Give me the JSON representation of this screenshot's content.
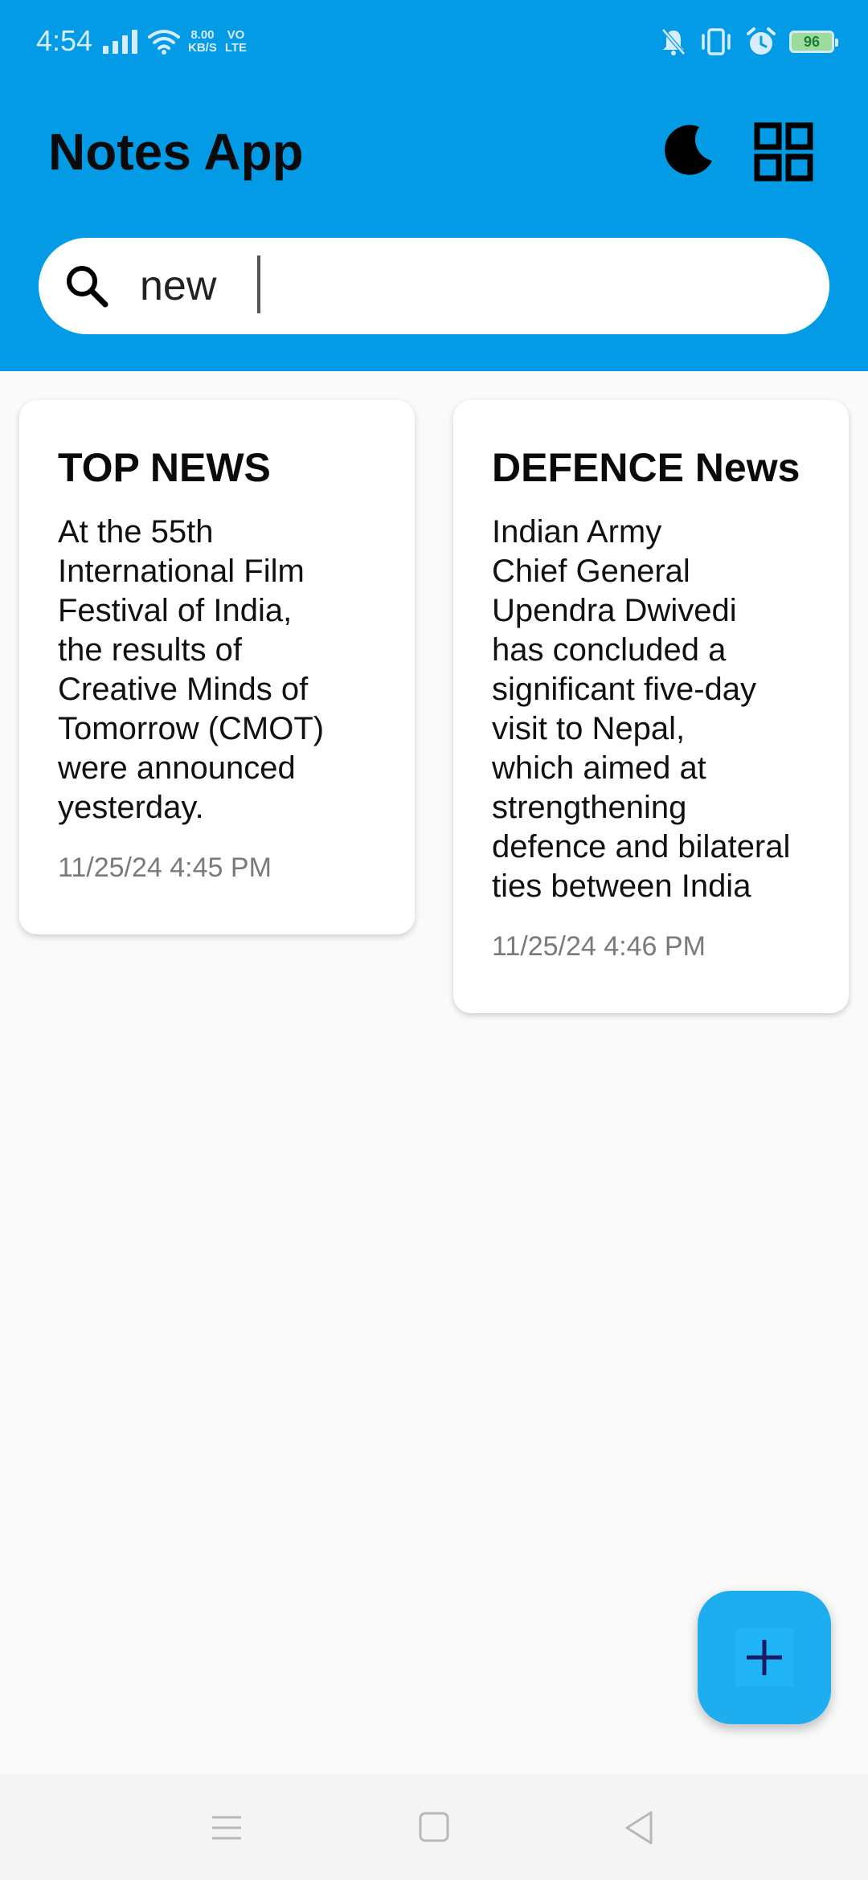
{
  "status_bar": {
    "time": "4:54",
    "net_speed_value": "8.00",
    "net_speed_unit": "KB/S",
    "volte_top": "VO",
    "volte_bottom": "LTE",
    "battery_level": "96",
    "icons": [
      "signal-icon",
      "wifi-icon",
      "mute-icon",
      "vibrate-icon",
      "alarm-icon",
      "battery-icon"
    ]
  },
  "app_bar": {
    "title": "Notes App",
    "theme_icon": "moon-icon",
    "layout_icon": "grid-icon"
  },
  "search": {
    "value": "new",
    "icon": "search-icon"
  },
  "notes": [
    {
      "title": "TOP NEWS",
      "body_lines": [
        "At the 55th",
        "International Film",
        "Festival of India,",
        "the results of",
        "Creative Minds of",
        "Tomorrow (CMOT)",
        "were announced",
        "yesterday."
      ],
      "date": "11/25/24 4:45 PM"
    },
    {
      "title": "DEFENCE News",
      "body_lines": [
        "Indian Army",
        "Chief General",
        "Upendra Dwivedi",
        "has concluded a",
        "significant five-day",
        "visit to Nepal,",
        "which aimed at",
        "strengthening",
        "defence and bilateral",
        "ties between India"
      ],
      "date": "11/25/24 4:46 PM"
    }
  ],
  "fab": {
    "icon": "plus-icon"
  },
  "nav_bar": {
    "icons": [
      "menu-icon",
      "home-icon",
      "back-icon"
    ]
  },
  "colors": {
    "app_bar": "#039be5",
    "background": "#fafafa",
    "fab": "#1eaef0",
    "fab_icon": "#1a1a66"
  }
}
